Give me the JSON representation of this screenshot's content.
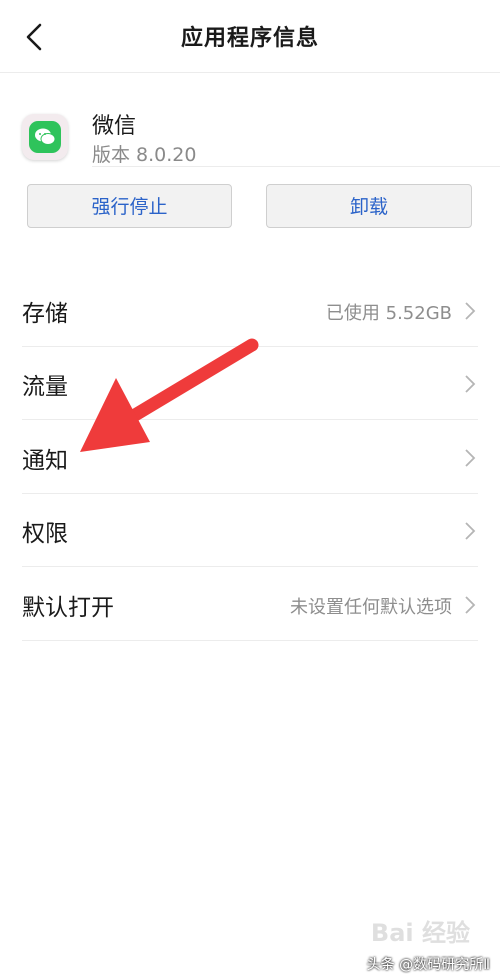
{
  "header": {
    "title": "应用程序信息",
    "back_icon": "chevron-left-icon"
  },
  "app": {
    "name": "微信",
    "version": "版本 8.0.20",
    "icon": "wechat-icon",
    "icon_color": "#2fc35b"
  },
  "actions": {
    "force_stop": "强行停止",
    "uninstall": "卸载"
  },
  "settings": [
    {
      "label": "存储",
      "value": "已使用 5.52GB"
    },
    {
      "label": "流量",
      "value": ""
    },
    {
      "label": "通知",
      "value": ""
    },
    {
      "label": "权限",
      "value": ""
    },
    {
      "label": "默认打开",
      "value": "未设置任何默认选项"
    }
  ],
  "annotation": {
    "type": "arrow",
    "color": "#ef3b3b",
    "points_to": "通知"
  },
  "watermark": {
    "text": "头条 @数码研究所Ⅱ",
    "logo_text": "Bai 经验"
  },
  "colors": {
    "accent": "#2b63c9",
    "divider": "#ececec",
    "secondary_text": "#8e8e8e"
  }
}
